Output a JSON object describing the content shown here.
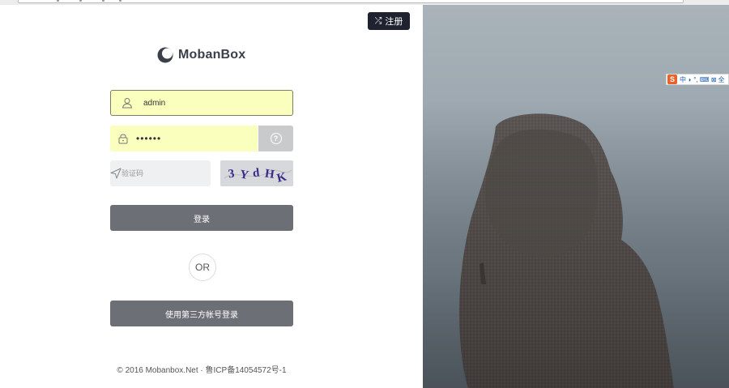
{
  "header": {
    "register_label": "注册",
    "register_icon": "shuffle-icon"
  },
  "brand": {
    "name": "MobanBox"
  },
  "form": {
    "username_value": "admin",
    "password_value": "••••••",
    "captcha_placeholder": "验证码",
    "captcha_text": "3YdHK",
    "login_label": "登录",
    "or_label": "OR",
    "social_label": "使用第三方帐号登录"
  },
  "footer": {
    "copyright": "© 2016 Mobanbox.Net · 鲁ICP备14054572号-1"
  },
  "ime_toolbar": {
    "logo": "S",
    "items": "中 ◗ °, ⌨ ⊠ 全"
  },
  "colors": {
    "dark_button": "#1f2330",
    "primary_button": "#6c6f76",
    "autofill_yellow": "#fbffbd"
  }
}
